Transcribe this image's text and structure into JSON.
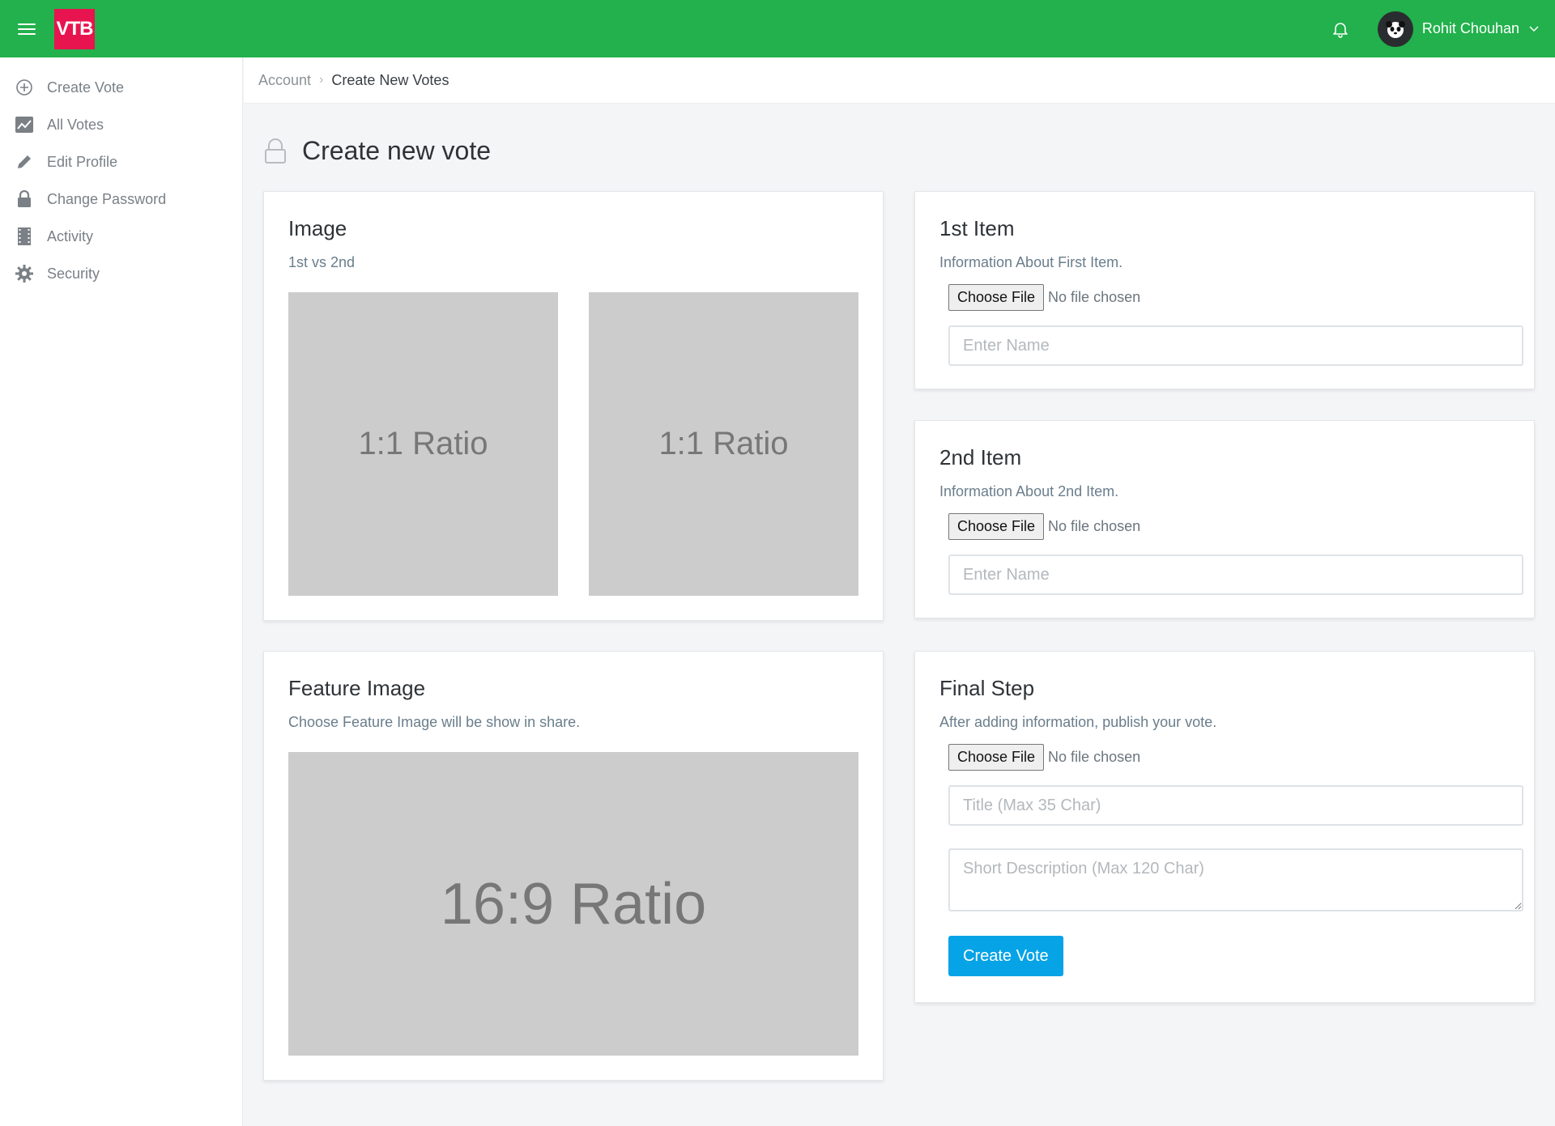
{
  "header": {
    "logo": "VTB",
    "user_name": "Rohit Chouhan",
    "brand_color": "#22b14c",
    "logo_color": "#e8144f"
  },
  "sidebar": {
    "items": [
      {
        "label": "Create Vote",
        "icon": "plus-circle-icon"
      },
      {
        "label": "All Votes",
        "icon": "chart-icon"
      },
      {
        "label": "Edit Profile",
        "icon": "pencil-icon"
      },
      {
        "label": "Change Password",
        "icon": "lock-icon"
      },
      {
        "label": "Activity",
        "icon": "film-icon"
      },
      {
        "label": "Security",
        "icon": "gear-icon"
      }
    ]
  },
  "breadcrumb": {
    "parent": "Account",
    "current": "Create New Votes"
  },
  "page": {
    "title": "Create new vote"
  },
  "image_card": {
    "title": "Image",
    "subtitle": "1st vs 2nd",
    "placeholder_1": "1:1 Ratio",
    "placeholder_2": "1:1 Ratio"
  },
  "feature_card": {
    "title": "Feature Image",
    "subtitle": "Choose Feature Image will be show in share.",
    "placeholder": "16:9 Ratio"
  },
  "item1_card": {
    "title": "1st Item",
    "subtitle": "Information About First Item.",
    "file_button": "Choose File",
    "file_status": "No file chosen",
    "name_placeholder": "Enter Name"
  },
  "item2_card": {
    "title": "2nd Item",
    "subtitle": "Information About 2nd Item.",
    "file_button": "Choose File",
    "file_status": "No file chosen",
    "name_placeholder": "Enter Name"
  },
  "final_card": {
    "title": "Final Step",
    "subtitle": "After adding information, publish your vote.",
    "file_button": "Choose File",
    "file_status": "No file chosen",
    "title_placeholder": "Title (Max 35 Char)",
    "description_placeholder": "Short Description (Max 120 Char)",
    "submit_label": "Create Vote",
    "submit_color": "#06a3e6"
  }
}
